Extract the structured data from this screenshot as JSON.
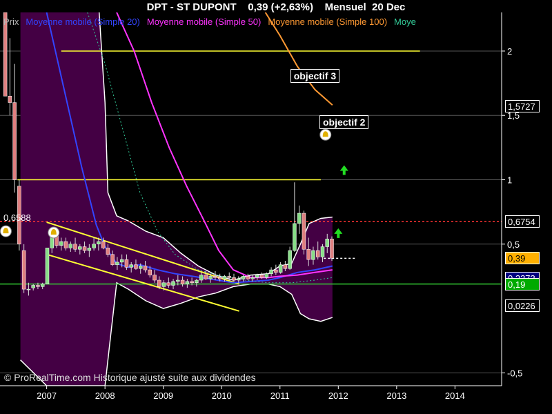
{
  "header": {
    "symbol": "DPT - ST DUPONT",
    "price": "0,39 (+2,63%)",
    "period": "Mensuel",
    "date": "20 Dec"
  },
  "legend": [
    {
      "label": "Prix",
      "color": "#bbbbbb"
    },
    {
      "label": "Moyenne mobile (Simple 20)",
      "color": "#3344ff"
    },
    {
      "label": "Moyenne mobile (Simple 50)",
      "color": "#ff33ff"
    },
    {
      "label": "Moyenne mobile (Simple 100)",
      "color": "#ff9933"
    },
    {
      "label": "Moye",
      "color": "#33cc99"
    }
  ],
  "copyright": "© ProRealTime.com Historique ajusté suite aux dividendes",
  "chart_data": {
    "type": "candlestick",
    "x_ticks": [
      "2007",
      "2008",
      "2009",
      "2010",
      "2011",
      "2012",
      "2013",
      "2014"
    ],
    "y_ticks": [
      {
        "label": "2",
        "value": 2
      },
      {
        "label": "1,5",
        "value": 1.5
      },
      {
        "label": "1",
        "value": 1
      },
      {
        "label": "0,5",
        "value": 0.5
      },
      {
        "label": "-0,5",
        "value": -0.5
      }
    ],
    "xlim": [
      2006.2,
      2014.8
    ],
    "ylim": [
      -0.6,
      2.3
    ],
    "reference_lines": [
      {
        "value": 2.0,
        "from": 2007.25,
        "to": 2013.4,
        "color": "#ffff33"
      },
      {
        "value": 1.0,
        "from": 2006.5,
        "to": 2011.7,
        "color": "#ffff33"
      },
      {
        "value": 0.6754,
        "color": "#ff3333",
        "dashed": true
      },
      {
        "value": 0.19,
        "color": "#33cc33"
      },
      {
        "value": 0.39,
        "from": 2011.75,
        "to": 2012.3,
        "color": "#ffffff",
        "dashed": true
      }
    ],
    "trend_lines": [
      {
        "from": [
          2007.0,
          0.67
        ],
        "to": [
          2010.3,
          0.19
        ],
        "color": "#ffff33"
      },
      {
        "from": [
          2007.0,
          0.42
        ],
        "to": [
          2010.3,
          -0.02
        ],
        "color": "#ffff33"
      },
      {
        "from": [
          2011.7,
          1.41
        ],
        "to": [
          2012.0,
          1.41
        ],
        "color": "#ffff33"
      }
    ],
    "price_tags": [
      {
        "label": "1,5727",
        "value": 1.5727,
        "bg": "#000000",
        "fg": "#ffffff"
      },
      {
        "label": "0,6754",
        "value": 0.6754,
        "bg": "#000000",
        "fg": "#ffffff"
      },
      {
        "label": "0,39",
        "value": 0.39,
        "bg": "#ffb000",
        "fg": "#000000"
      },
      {
        "label": "0,2373",
        "value": 0.2373,
        "bg": "#000080",
        "fg": "#ffffff"
      },
      {
        "label": "0,19",
        "value": 0.19,
        "bg": "#00aa00",
        "fg": "#ffffff"
      },
      {
        "label": "0,0226",
        "value": 0.0226,
        "bg": "#000000",
        "fg": "#ffffff"
      }
    ],
    "side_labels": [
      {
        "label": "0,6588",
        "value": 0.6588
      }
    ],
    "annotations": [
      {
        "label": "objectif 3",
        "x": 2011.65,
        "y": 1.8
      },
      {
        "label": "objectif 2",
        "x": 2012.15,
        "y": 1.44
      }
    ],
    "alerts": [
      {
        "x": 2006.3,
        "y": 0.6
      },
      {
        "x": 2007.12,
        "y": 0.59
      },
      {
        "x": 2011.78,
        "y": 1.35
      }
    ],
    "arrows": [
      {
        "x": 2012.1,
        "y": 1.07
      },
      {
        "x": 2012.0,
        "y": 0.58
      }
    ],
    "bollinger": {
      "color": "#440044",
      "upper": [
        [
          2006.55,
          2.3
        ],
        [
          2007.0,
          2.3
        ],
        [
          2007.5,
          2.3
        ],
        [
          2007.9,
          2.3
        ],
        [
          2008.0,
          1.6
        ],
        [
          2008.05,
          0.9
        ],
        [
          2008.2,
          0.72
        ],
        [
          2008.4,
          0.68
        ],
        [
          2008.7,
          0.6
        ],
        [
          2009.0,
          0.55
        ],
        [
          2009.3,
          0.43
        ],
        [
          2009.6,
          0.33
        ],
        [
          2009.9,
          0.26
        ],
        [
          2010.2,
          0.22
        ],
        [
          2010.5,
          0.26
        ],
        [
          2010.8,
          0.27
        ],
        [
          2011.0,
          0.33
        ],
        [
          2011.2,
          0.35
        ],
        [
          2011.35,
          0.5
        ],
        [
          2011.5,
          0.66
        ],
        [
          2011.7,
          0.7
        ],
        [
          2011.9,
          0.71
        ]
      ],
      "lower": [
        [
          2011.9,
          -0.07
        ],
        [
          2011.7,
          -0.1
        ],
        [
          2011.5,
          -0.08
        ],
        [
          2011.35,
          -0.04
        ],
        [
          2011.2,
          0.11
        ],
        [
          2011.0,
          0.17
        ],
        [
          2010.8,
          0.19
        ],
        [
          2010.5,
          0.19
        ],
        [
          2010.2,
          0.17
        ],
        [
          2009.9,
          0.12
        ],
        [
          2009.6,
          0.09
        ],
        [
          2009.3,
          0.04
        ],
        [
          2009.0,
          0.0
        ],
        [
          2008.7,
          0.06
        ],
        [
          2008.4,
          0.15
        ],
        [
          2008.2,
          0.2
        ],
        [
          2008.1,
          -0.2
        ],
        [
          2008.0,
          -0.6
        ],
        [
          2007.2,
          -0.6
        ],
        [
          2007.0,
          -0.6
        ],
        [
          2006.55,
          -0.4
        ]
      ]
    },
    "band_edges": {
      "color": "#ffffff",
      "upper": [
        [
          2007.9,
          2.3
        ],
        [
          2008.0,
          1.6
        ],
        [
          2008.05,
          0.9
        ],
        [
          2008.2,
          0.72
        ],
        [
          2008.4,
          0.68
        ],
        [
          2008.7,
          0.6
        ],
        [
          2009.0,
          0.55
        ],
        [
          2009.3,
          0.43
        ],
        [
          2009.6,
          0.33
        ],
        [
          2009.9,
          0.26
        ],
        [
          2010.2,
          0.22
        ],
        [
          2010.5,
          0.26
        ],
        [
          2010.8,
          0.27
        ],
        [
          2011.0,
          0.33
        ],
        [
          2011.2,
          0.35
        ],
        [
          2011.35,
          0.5
        ],
        [
          2011.5,
          0.66
        ],
        [
          2011.7,
          0.7
        ],
        [
          2011.9,
          0.71
        ]
      ],
      "lower": [
        [
          2006.55,
          -0.4
        ],
        [
          2007.0,
          -0.6
        ],
        [
          2008.0,
          -0.6
        ],
        [
          2008.1,
          -0.2
        ],
        [
          2008.2,
          0.2
        ],
        [
          2008.4,
          0.15
        ],
        [
          2008.7,
          0.06
        ],
        [
          2009.0,
          0.0
        ],
        [
          2009.3,
          0.04
        ],
        [
          2009.6,
          0.09
        ],
        [
          2009.9,
          0.12
        ],
        [
          2010.2,
          0.17
        ],
        [
          2010.5,
          0.19
        ],
        [
          2010.8,
          0.19
        ],
        [
          2011.0,
          0.17
        ],
        [
          2011.2,
          0.11
        ],
        [
          2011.35,
          -0.04
        ],
        [
          2011.5,
          -0.08
        ],
        [
          2011.7,
          -0.1
        ],
        [
          2011.9,
          -0.07
        ]
      ]
    },
    "series": [
      {
        "name": "Moyenne mobile (Simple 20)",
        "color": "#3344ff",
        "points": [
          [
            2007.0,
            2.3
          ],
          [
            2007.3,
            1.7
          ],
          [
            2007.6,
            1.1
          ],
          [
            2007.85,
            0.65
          ],
          [
            2008.0,
            0.48
          ],
          [
            2008.2,
            0.35
          ],
          [
            2008.4,
            0.32
          ],
          [
            2008.6,
            0.34
          ],
          [
            2008.9,
            0.3
          ],
          [
            2009.2,
            0.27
          ],
          [
            2009.5,
            0.25
          ],
          [
            2009.8,
            0.23
          ],
          [
            2010.2,
            0.2
          ],
          [
            2010.5,
            0.21
          ],
          [
            2010.8,
            0.22
          ],
          [
            2011.0,
            0.24
          ],
          [
            2011.3,
            0.28
          ],
          [
            2011.6,
            0.3
          ],
          [
            2011.9,
            0.33
          ]
        ]
      },
      {
        "name": "Moyenne mobile (Simple 50)",
        "color": "#ff33ff",
        "points": [
          [
            2008.2,
            2.3
          ],
          [
            2008.5,
            2.0
          ],
          [
            2008.8,
            1.6
          ],
          [
            2009.1,
            1.25
          ],
          [
            2009.4,
            0.95
          ],
          [
            2009.7,
            0.68
          ],
          [
            2009.95,
            0.45
          ],
          [
            2010.2,
            0.3
          ],
          [
            2010.5,
            0.24
          ],
          [
            2010.8,
            0.24
          ],
          [
            2011.0,
            0.25
          ],
          [
            2011.3,
            0.26
          ],
          [
            2011.6,
            0.28
          ],
          [
            2011.9,
            0.3
          ]
        ]
      },
      {
        "name": "Moyenne mobile (Simple 100)",
        "color": "#ff9933",
        "points": [
          [
            2010.75,
            2.3
          ],
          [
            2011.0,
            2.12
          ],
          [
            2011.3,
            1.88
          ],
          [
            2011.6,
            1.7
          ],
          [
            2011.9,
            1.58
          ]
        ]
      },
      {
        "name": "Moye",
        "color": "#33cc99",
        "dashed": true,
        "points": [
          [
            2007.7,
            2.3
          ],
          [
            2008.0,
            1.9
          ],
          [
            2008.3,
            1.4
          ],
          [
            2008.6,
            0.9
          ],
          [
            2008.9,
            0.6
          ],
          [
            2009.2,
            0.42
          ],
          [
            2009.6,
            0.3
          ],
          [
            2010.0,
            0.25
          ],
          [
            2010.4,
            0.22
          ],
          [
            2010.8,
            0.2
          ],
          [
            2011.2,
            0.2
          ],
          [
            2011.6,
            0.22
          ],
          [
            2011.9,
            0.24
          ]
        ]
      }
    ],
    "candles": [
      [
        2006.29,
        2.3,
        2.3,
        1.95,
        1.65
      ],
      [
        2006.37,
        1.65,
        2.1,
        1.5,
        1.6
      ],
      [
        2006.45,
        1.6,
        1.9,
        0.9,
        1.0
      ],
      [
        2006.53,
        0.95,
        1.0,
        0.45,
        0.5
      ],
      [
        2006.61,
        0.45,
        0.5,
        0.12,
        0.15
      ],
      [
        2006.69,
        0.15,
        0.2,
        0.1,
        0.15
      ],
      [
        2006.77,
        0.16,
        0.19,
        0.14,
        0.18
      ],
      [
        2006.85,
        0.18,
        0.2,
        0.15,
        0.17
      ],
      [
        2006.93,
        0.17,
        0.2,
        0.15,
        0.19
      ],
      [
        2007.01,
        0.19,
        0.47,
        0.19,
        0.47
      ],
      [
        2007.09,
        0.47,
        0.62,
        0.43,
        0.57
      ],
      [
        2007.17,
        0.57,
        0.6,
        0.47,
        0.49
      ],
      [
        2007.25,
        0.49,
        0.55,
        0.45,
        0.52
      ],
      [
        2007.33,
        0.52,
        0.55,
        0.45,
        0.47
      ],
      [
        2007.41,
        0.47,
        0.52,
        0.44,
        0.5
      ],
      [
        2007.49,
        0.5,
        0.55,
        0.44,
        0.46
      ],
      [
        2007.57,
        0.46,
        0.5,
        0.42,
        0.48
      ],
      [
        2007.65,
        0.48,
        0.52,
        0.43,
        0.45
      ],
      [
        2007.73,
        0.45,
        0.5,
        0.4,
        0.47
      ],
      [
        2007.81,
        0.47,
        0.55,
        0.45,
        0.5
      ],
      [
        2007.89,
        0.5,
        0.55,
        0.45,
        0.52
      ],
      [
        2007.97,
        0.52,
        0.55,
        0.46,
        0.47
      ],
      [
        2008.05,
        0.47,
        0.5,
        0.4,
        0.42
      ],
      [
        2008.13,
        0.42,
        0.45,
        0.33,
        0.34
      ],
      [
        2008.21,
        0.34,
        0.4,
        0.3,
        0.36
      ],
      [
        2008.29,
        0.36,
        0.42,
        0.32,
        0.38
      ],
      [
        2008.37,
        0.38,
        0.42,
        0.3,
        0.32
      ],
      [
        2008.45,
        0.32,
        0.36,
        0.28,
        0.34
      ],
      [
        2008.53,
        0.34,
        0.38,
        0.3,
        0.31
      ],
      [
        2008.61,
        0.31,
        0.35,
        0.27,
        0.33
      ],
      [
        2008.69,
        0.33,
        0.37,
        0.28,
        0.3
      ],
      [
        2008.77,
        0.3,
        0.33,
        0.24,
        0.26
      ],
      [
        2008.85,
        0.26,
        0.3,
        0.2,
        0.22
      ],
      [
        2008.93,
        0.22,
        0.25,
        0.15,
        0.17
      ],
      [
        2009.01,
        0.17,
        0.22,
        0.14,
        0.2
      ],
      [
        2009.09,
        0.2,
        0.24,
        0.16,
        0.18
      ],
      [
        2009.17,
        0.18,
        0.23,
        0.15,
        0.21
      ],
      [
        2009.25,
        0.21,
        0.26,
        0.18,
        0.22
      ],
      [
        2009.33,
        0.22,
        0.25,
        0.17,
        0.19
      ],
      [
        2009.41,
        0.19,
        0.23,
        0.16,
        0.21
      ],
      [
        2009.49,
        0.21,
        0.24,
        0.18,
        0.2
      ],
      [
        2009.57,
        0.2,
        0.23,
        0.17,
        0.22
      ],
      [
        2009.65,
        0.22,
        0.28,
        0.2,
        0.26
      ],
      [
        2009.73,
        0.26,
        0.29,
        0.22,
        0.23
      ],
      [
        2009.81,
        0.23,
        0.27,
        0.2,
        0.25
      ],
      [
        2009.89,
        0.25,
        0.29,
        0.22,
        0.24
      ],
      [
        2009.97,
        0.24,
        0.27,
        0.21,
        0.23
      ],
      [
        2010.05,
        0.23,
        0.26,
        0.21,
        0.25
      ],
      [
        2010.13,
        0.25,
        0.28,
        0.22,
        0.24
      ],
      [
        2010.21,
        0.24,
        0.27,
        0.21,
        0.22
      ],
      [
        2010.29,
        0.22,
        0.25,
        0.2,
        0.23
      ],
      [
        2010.37,
        0.23,
        0.26,
        0.21,
        0.25
      ],
      [
        2010.45,
        0.25,
        0.27,
        0.22,
        0.23
      ],
      [
        2010.53,
        0.23,
        0.26,
        0.21,
        0.24
      ],
      [
        2010.61,
        0.24,
        0.27,
        0.22,
        0.26
      ],
      [
        2010.69,
        0.26,
        0.28,
        0.23,
        0.24
      ],
      [
        2010.77,
        0.24,
        0.28,
        0.23,
        0.27
      ],
      [
        2010.85,
        0.27,
        0.32,
        0.25,
        0.3
      ],
      [
        2010.93,
        0.3,
        0.34,
        0.26,
        0.28
      ],
      [
        2011.01,
        0.28,
        0.36,
        0.27,
        0.34
      ],
      [
        2011.09,
        0.34,
        0.37,
        0.29,
        0.31
      ],
      [
        2011.17,
        0.31,
        0.48,
        0.3,
        0.45
      ],
      [
        2011.25,
        0.45,
        0.98,
        0.44,
        0.66
      ],
      [
        2011.33,
        0.66,
        0.8,
        0.58,
        0.74
      ],
      [
        2011.41,
        0.74,
        0.76,
        0.42,
        0.46
      ],
      [
        2011.49,
        0.46,
        0.55,
        0.33,
        0.38
      ],
      [
        2011.57,
        0.38,
        0.48,
        0.34,
        0.45
      ],
      [
        2011.65,
        0.45,
        0.52,
        0.38,
        0.4
      ],
      [
        2011.73,
        0.4,
        0.5,
        0.36,
        0.48
      ],
      [
        2011.81,
        0.48,
        0.58,
        0.43,
        0.54
      ],
      [
        2011.89,
        0.54,
        0.56,
        0.37,
        0.39
      ]
    ]
  }
}
